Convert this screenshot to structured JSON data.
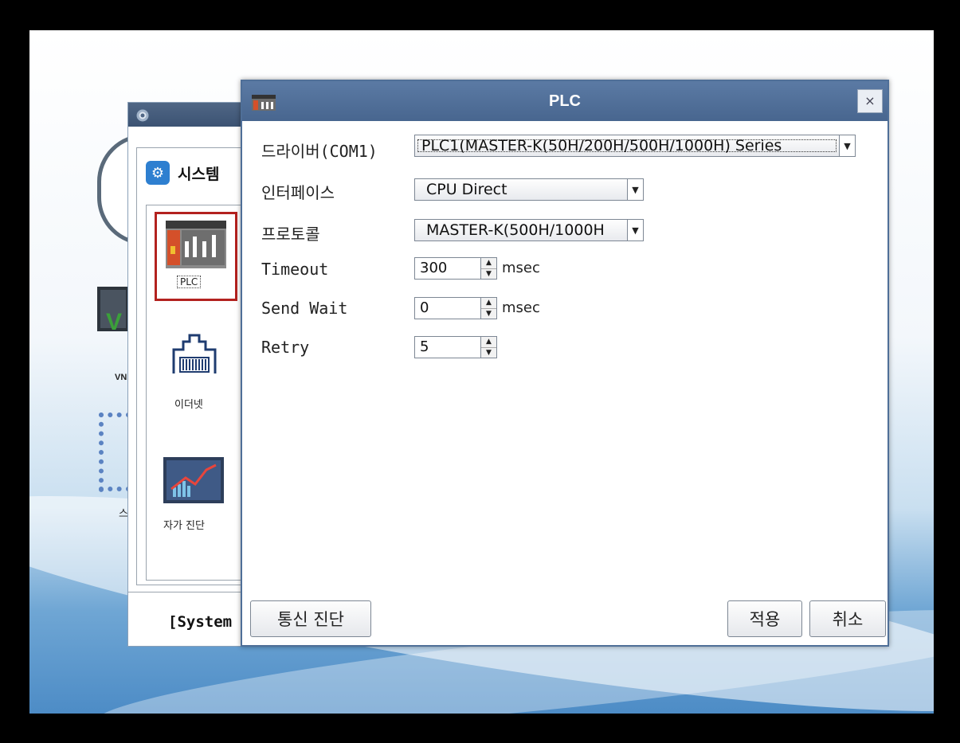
{
  "background": {
    "vnc_label": "VN",
    "partial_label": "스"
  },
  "system_window": {
    "header_text": "시스템",
    "items": [
      {
        "label": "PLC",
        "icon": "plc-icon"
      },
      {
        "label": "이더넷",
        "icon": "ethernet-icon"
      },
      {
        "label": "자가 진단",
        "icon": "diagnostics-icon"
      }
    ],
    "footer_text": "[System"
  },
  "dialog": {
    "title": "PLC",
    "close_label": "×",
    "fields": {
      "driver": {
        "label": "드라이버(COM1)",
        "value": "PLC1(MASTER-K(50H/200H/500H/1000H) Series"
      },
      "interface": {
        "label": "인터페이스",
        "value": "CPU Direct"
      },
      "protocol": {
        "label": "프로토콜",
        "value": "MASTER-K(500H/1000H"
      },
      "timeout": {
        "label": "Timeout",
        "value": "300",
        "unit": "msec"
      },
      "send_wait": {
        "label": "Send Wait",
        "value": "0",
        "unit": "msec"
      },
      "retry": {
        "label": "Retry",
        "value": "5"
      }
    },
    "buttons": {
      "diagnose": "통신 진단",
      "apply": "적용",
      "cancel": "취소"
    }
  },
  "colors": {
    "title_bar": "#4f6f98",
    "selection_border": "#b3221f"
  }
}
